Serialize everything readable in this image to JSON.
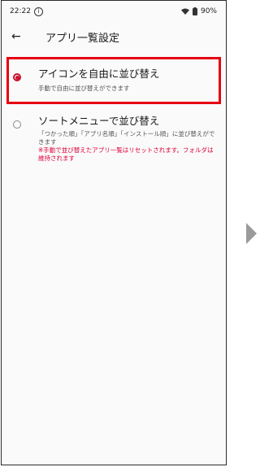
{
  "status_bar": {
    "time": "22:22",
    "info_icon": "info-icon",
    "battery": "90%"
  },
  "app_bar": {
    "back_icon": "←",
    "title": "アプリ一覧設定"
  },
  "options": [
    {
      "title": "アイコンを自由に並び替え",
      "subtitle": "手動で自由に並び替えができます",
      "selected": true
    },
    {
      "title": "ソートメニューで並び替え",
      "subtitle": "「つかった順」「アプリ名順」「インストール順」に並び替えができます",
      "warning": "※手動で並び替えたアプリ一覧はリセットされます。フォルダは維持されます",
      "selected": false
    }
  ],
  "colors": {
    "accent": "#c8102e",
    "highlight": "#e60012",
    "warning": "#e0003a"
  }
}
